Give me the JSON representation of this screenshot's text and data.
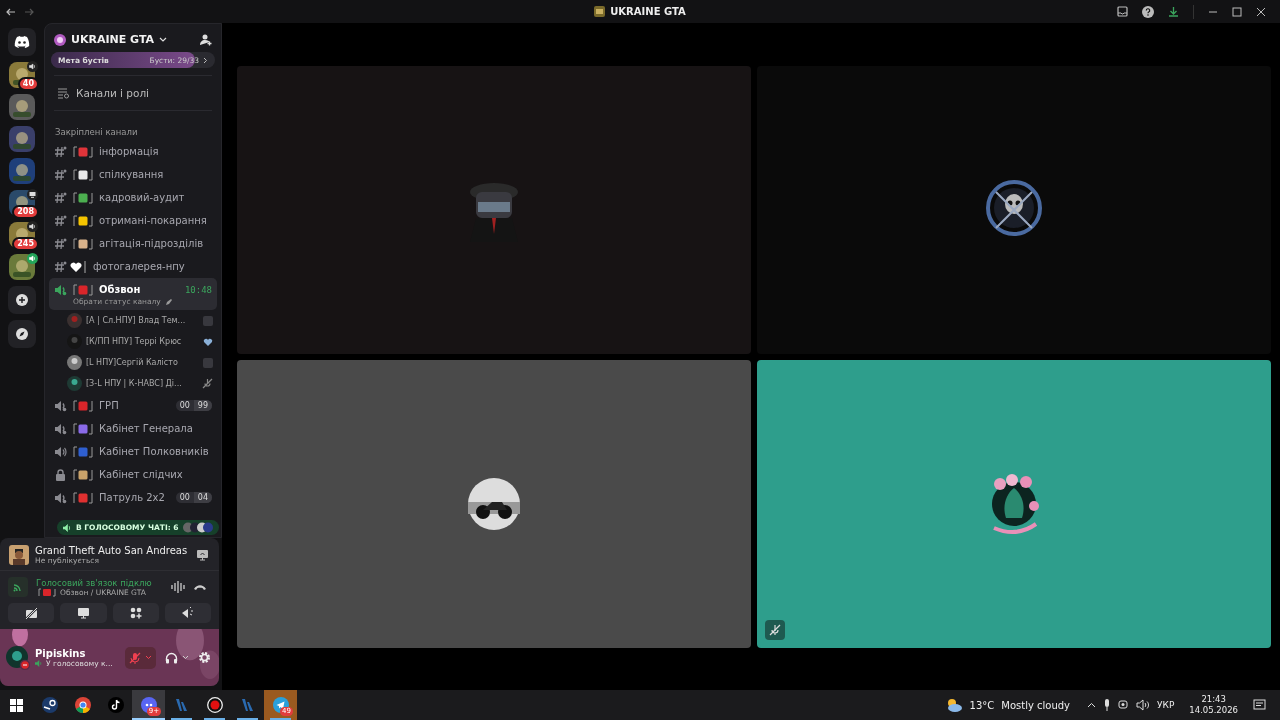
{
  "window": {
    "title": "UKRAINE GTA"
  },
  "servers": [
    {
      "kind": "home",
      "selected": false
    },
    {
      "kind": "speaker",
      "badge": "40",
      "color": "#8a7a3a"
    },
    {
      "kind": "plain",
      "color": "#5a5a5a"
    },
    {
      "kind": "plain",
      "color": "#3a3f6a"
    },
    {
      "kind": "plain",
      "color": "#1f3f7a"
    },
    {
      "kind": "screen",
      "badge": "208",
      "color": "#2a4a6a"
    },
    {
      "kind": "speaker",
      "badge": "245",
      "color": "#8a7a3a"
    },
    {
      "kind": "talking",
      "color": "#6a7a3a"
    },
    {
      "kind": "add"
    },
    {
      "kind": "discover"
    }
  ],
  "server": {
    "name": "UKRAINE GTA",
    "boost_label": "Мета бустів",
    "boost_count": "Бусти: 29/33",
    "level": 0.88,
    "roles_link": "Канали і ролі",
    "pinned_heading": "Закріплені канали"
  },
  "channels": [
    {
      "kind": "text",
      "name": "інформація",
      "color": "#e0343a",
      "selected": false
    },
    {
      "kind": "text",
      "name": "спілкування",
      "color": "#e8e8e8",
      "selected": false
    },
    {
      "kind": "text",
      "name": "кадровий-аудит",
      "color": "#4caf50",
      "selected": false
    },
    {
      "kind": "text",
      "name": "отримані-покарання",
      "color": "#f5c400",
      "selected": false
    },
    {
      "kind": "text",
      "name": "агітація-підрозділів",
      "color": "#d9b38c",
      "selected": false
    },
    {
      "kind": "heart",
      "name": "фотогалерея-нпу",
      "color": "#ffffff",
      "selected": false
    },
    {
      "kind": "voice",
      "name": "Обзвон",
      "color": "#d9252a",
      "selected": true,
      "time": "10:48",
      "status": "Обрати статус каналу",
      "members": [
        {
          "name": "[A | Сл.НПУ] Влад Тем...",
          "kind": "activity"
        },
        {
          "name": "[К/ПП НПУ] Террі Крюс",
          "kind": "heart"
        },
        {
          "name": "[L НПУ]Сергій Калісто",
          "kind": "activity"
        },
        {
          "name": "[З-L НПУ | К-НАВС] Ді...",
          "kind": "muted"
        }
      ]
    },
    {
      "kind": "voice",
      "name": "ГРП",
      "color": "#d9252a",
      "selected": false,
      "counts": [
        "00",
        "99"
      ]
    },
    {
      "kind": "voice",
      "name": "Кабінет Генерала",
      "color": "#8a6ae8",
      "selected": false
    },
    {
      "kind": "speaker",
      "name": "Кабінет Полковників",
      "color": "#2f5fd0",
      "selected": false
    },
    {
      "kind": "locked",
      "name": "Кабінет слідчих",
      "color": "#c9a26a",
      "selected": false
    },
    {
      "kind": "voice",
      "name": "Патруль 2х2",
      "color": "#e03030",
      "selected": false,
      "counts": [
        "00",
        "04"
      ]
    }
  ],
  "voice_pill": "В ГОЛОСОВОМУ ЧАТІ: 6",
  "activity": {
    "game": "Grand Theft Auto San Andreas",
    "status": "Не публікується"
  },
  "connection": {
    "status": "Голосовий зв'язок підклю",
    "channel": "Обзвон / UKRAINE GTA"
  },
  "user": {
    "name": "Pipiskins",
    "status": "У голосовому к...",
    "mic_muted": true,
    "deafened": false
  },
  "tiles": [
    {
      "color": "#171314",
      "muted": false
    },
    {
      "color": "#0a0a0a",
      "muted": false
    },
    {
      "color": "#4a4a4a",
      "muted": false
    },
    {
      "color": "#2e9e8c",
      "muted": true
    }
  ],
  "taskbar": {
    "apps": [
      {
        "kind": "windows",
        "selected": false,
        "running": false
      },
      {
        "kind": "steam",
        "selected": false,
        "running": false
      },
      {
        "kind": "chrome",
        "selected": false,
        "running": false
      },
      {
        "kind": "tiktok",
        "selected": false,
        "running": false
      },
      {
        "kind": "discord",
        "selected": true,
        "running": true,
        "badge": "9+"
      },
      {
        "kind": "game",
        "selected": false,
        "running": true
      },
      {
        "kind": "record",
        "selected": false,
        "running": true
      },
      {
        "kind": "game",
        "selected": false,
        "running": true
      },
      {
        "kind": "telegram",
        "selected": false,
        "running": true,
        "flashing": true,
        "badge": "49"
      }
    ],
    "temperature": "13°C",
    "weather": "Mostly cloudy",
    "language": "УКР",
    "time": "21:43",
    "date": "14.05.2026"
  }
}
